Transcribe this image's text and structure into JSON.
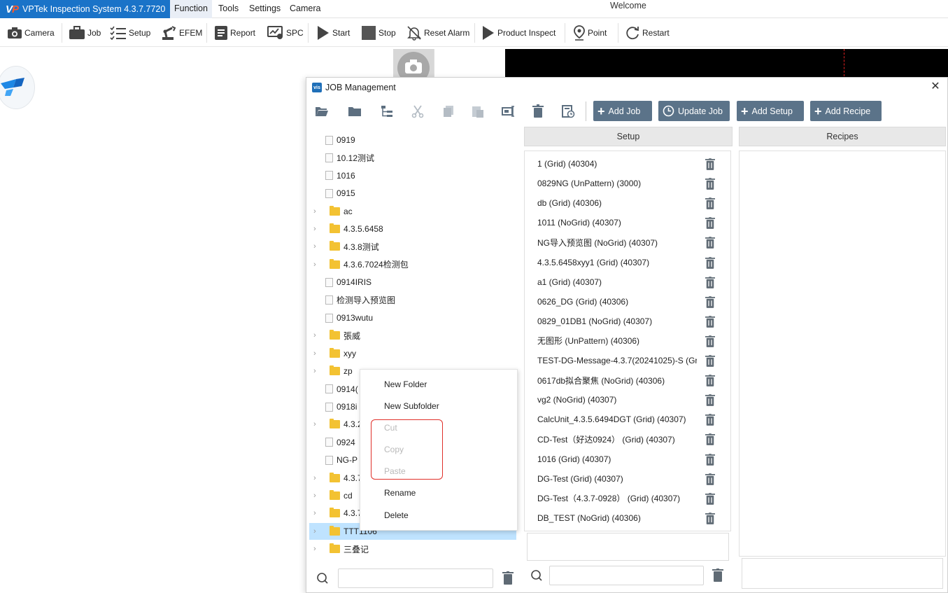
{
  "menubar": {
    "brand_logo": "VP",
    "app_title": "VPTek Inspection System 4.3.7.7720",
    "items": [
      "Function",
      "Tools",
      "Settings",
      "Camera"
    ],
    "welcome": "Welcome"
  },
  "toolbar": {
    "camera": "Camera",
    "job": "Job",
    "setup": "Setup",
    "efem": "EFEM",
    "report": "Report",
    "spc": "SPC",
    "start": "Start",
    "stop": "Stop",
    "reset_alarm": "Reset Alarm",
    "product_inspect": "Product Inspect",
    "point": "Point",
    "restart": "Restart"
  },
  "dialog": {
    "app_icon": "vis",
    "title": "JOB Management",
    "close": "✕",
    "buttons": {
      "add_job": "Add Job",
      "update_job": "Update Job",
      "add_setup": "Add Setup",
      "add_recipe": "Add Recipe"
    },
    "tree": [
      {
        "label": "0919",
        "type": "file"
      },
      {
        "label": "10.12测试",
        "type": "file"
      },
      {
        "label": "1016",
        "type": "file"
      },
      {
        "label": "0915",
        "type": "file"
      },
      {
        "label": "ac",
        "type": "folder"
      },
      {
        "label": "4.3.5.6458",
        "type": "folder"
      },
      {
        "label": "4.3.8测试",
        "type": "folder"
      },
      {
        "label": "4.3.6.7024检测包",
        "type": "folder"
      },
      {
        "label": "0914IRIS",
        "type": "file"
      },
      {
        "label": "检测导入预览图",
        "type": "file"
      },
      {
        "label": "0913wutu",
        "type": "file"
      },
      {
        "label": "張威",
        "type": "folder"
      },
      {
        "label": "xyy",
        "type": "folder"
      },
      {
        "label": "zp",
        "type": "folder"
      },
      {
        "label": "0914(",
        "type": "file"
      },
      {
        "label": "0918i",
        "type": "file"
      },
      {
        "label": "4.3.2.",
        "type": "folder"
      },
      {
        "label": "0924",
        "type": "file"
      },
      {
        "label": "NG-P",
        "type": "file"
      },
      {
        "label": "4.3.7",
        "type": "folder"
      },
      {
        "label": "cd",
        "type": "folder"
      },
      {
        "label": "4.3.7",
        "type": "folder"
      },
      {
        "label": "TTT1106",
        "type": "folder",
        "selected": true
      },
      {
        "label": "三叠记",
        "type": "folder"
      }
    ],
    "setup_header": "Setup",
    "recipes_header": "Recipes",
    "setups": [
      "1 (Grid) (40304)",
      "0829NG (UnPattern) (3000)",
      "db (Grid) (40306)",
      "1011 (NoGrid) (40307)",
      "NG导入预览图 (NoGrid) (40307)",
      "4.3.5.6458xyy1 (Grid) (40307)",
      "a1 (Grid) (40307)",
      "0626_DG (Grid) (40306)",
      "0829_01DB1 (NoGrid) (40307)",
      "无图形 (UnPattern) (40306)",
      "TEST-DG-Message-4.3.7(20241025)-S (Gri",
      "0617db拟合聚焦 (NoGrid) (40306)",
      "vg2 (NoGrid) (40307)",
      "CalcUnit_4.3.5.6494DGT (Grid) (40307)",
      "CD-Test（好达0924） (Grid) (40307)",
      "1016 (Grid) (40307)",
      "DG-Test (Grid) (40307)",
      "DG-Test（4.3.7-0928） (Grid) (40307)",
      "DB_TEST (NoGrid) (40306)"
    ],
    "tree_search": {
      "value": "",
      "placeholder": ""
    },
    "setup_search": {
      "value": "",
      "placeholder": ""
    }
  },
  "context_menu": {
    "items": [
      {
        "label": "New Folder",
        "enabled": true
      },
      {
        "label": "New Subfolder",
        "enabled": true
      },
      {
        "label": "Cut",
        "enabled": false
      },
      {
        "label": "Copy",
        "enabled": false
      },
      {
        "label": "Paste",
        "enabled": false
      },
      {
        "label": "Rename",
        "enabled": true
      },
      {
        "label": "Delete",
        "enabled": true
      }
    ]
  },
  "colors": {
    "brand_blue": "#1a73c8",
    "action_button": "#5b7389",
    "selection": "#bfe3ff",
    "highlight_border": "#e0302a",
    "folder": "#f3c232"
  }
}
